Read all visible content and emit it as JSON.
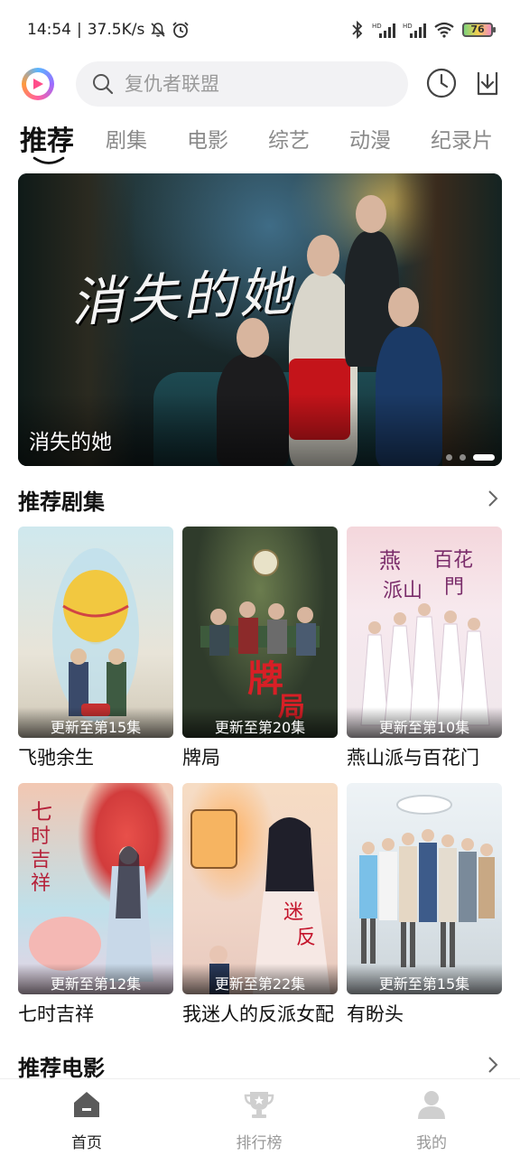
{
  "status_bar": {
    "time": "14:54",
    "speed": "37.5K/s",
    "battery": "76"
  },
  "search": {
    "placeholder": "复仇者联盟"
  },
  "tabs": [
    {
      "label": "推荐"
    },
    {
      "label": "剧集"
    },
    {
      "label": "电影"
    },
    {
      "label": "综艺"
    },
    {
      "label": "动漫"
    },
    {
      "label": "纪录片"
    }
  ],
  "banner": {
    "art_title": "消失的她",
    "caption": "消失的她",
    "slide_count": 3,
    "active_slide": 3
  },
  "sections": [
    {
      "title": "推荐剧集",
      "items": [
        {
          "title": "飞驰余生",
          "badge": "更新至第15集"
        },
        {
          "title": "牌局",
          "badge": "更新至第20集"
        },
        {
          "title": "燕山派与百花门",
          "badge": "更新至第10集"
        },
        {
          "title": "七时吉祥",
          "badge": "更新至第12集"
        },
        {
          "title": "我迷人的反派女配",
          "badge": "更新至第22集"
        },
        {
          "title": "有盼头",
          "badge": "更新至第15集"
        }
      ]
    },
    {
      "title": "推荐电影"
    }
  ],
  "bottom_nav": [
    {
      "label": "首页",
      "icon": "home-icon",
      "active": true
    },
    {
      "label": "排行榜",
      "icon": "trophy-icon",
      "active": false
    },
    {
      "label": "我的",
      "icon": "profile-icon",
      "active": false
    }
  ],
  "colors": {
    "accent_gradient": [
      "#59b5ff",
      "#9b6bff",
      "#ff5fa0"
    ],
    "text_primary": "#111111",
    "text_secondary": "#8a8a8a"
  }
}
